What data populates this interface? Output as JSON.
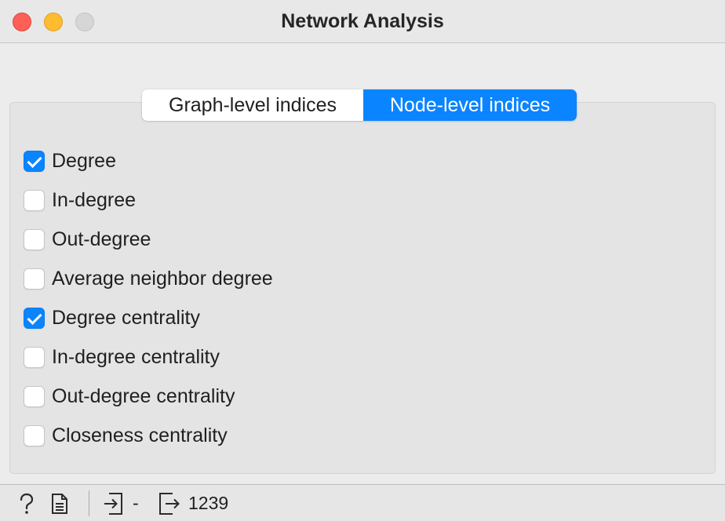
{
  "window": {
    "title": "Network Analysis"
  },
  "tabs": [
    {
      "label": "Graph-level indices",
      "active": false
    },
    {
      "label": "Node-level indices",
      "active": true
    }
  ],
  "options": [
    {
      "label": "Degree",
      "checked": true
    },
    {
      "label": "In-degree",
      "checked": false
    },
    {
      "label": "Out-degree",
      "checked": false
    },
    {
      "label": "Average neighbor degree",
      "checked": false
    },
    {
      "label": "Degree centrality",
      "checked": true
    },
    {
      "label": "In-degree centrality",
      "checked": false
    },
    {
      "label": "Out-degree centrality",
      "checked": false
    },
    {
      "label": "Closeness centrality",
      "checked": false
    }
  ],
  "statusbar": {
    "input_value": "-",
    "output_value": "1239",
    "icons": [
      "help-icon",
      "report-icon",
      "input-icon",
      "output-icon"
    ]
  },
  "colors": {
    "accent": "#0a84ff",
    "close": "#fe5f57",
    "minimize": "#febc2e",
    "maximize": "#d6d6d6"
  }
}
